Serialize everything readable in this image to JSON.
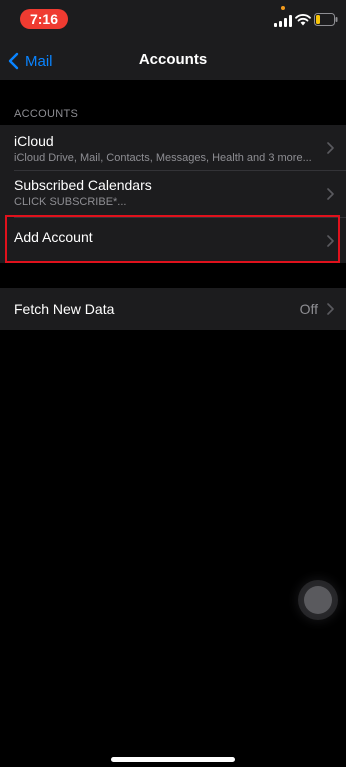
{
  "status_bar": {
    "time": "7:16"
  },
  "nav": {
    "back_label": "Mail",
    "title": "Accounts"
  },
  "accounts_section": {
    "header": "ACCOUNTS",
    "rows": [
      {
        "title": "iCloud",
        "subtitle": "iCloud Drive, Mail, Contacts, Messages, Health and 3 more..."
      },
      {
        "title": "Subscribed Calendars",
        "subtitle": "CLICK SUBSCRIBE*..."
      },
      {
        "title": "Add Account"
      }
    ]
  },
  "fetch_section": {
    "title": "Fetch New Data",
    "value": "Off"
  },
  "colors": {
    "accent": "#0a84ff",
    "highlight": "#e0111c",
    "time_pill": "#ef3b31",
    "background": "#000000",
    "cell": "#1c1c1e"
  },
  "icons": [
    "signal-icon",
    "wifi-icon",
    "battery-icon",
    "chevron-left-icon",
    "chevron-right-icon"
  ]
}
